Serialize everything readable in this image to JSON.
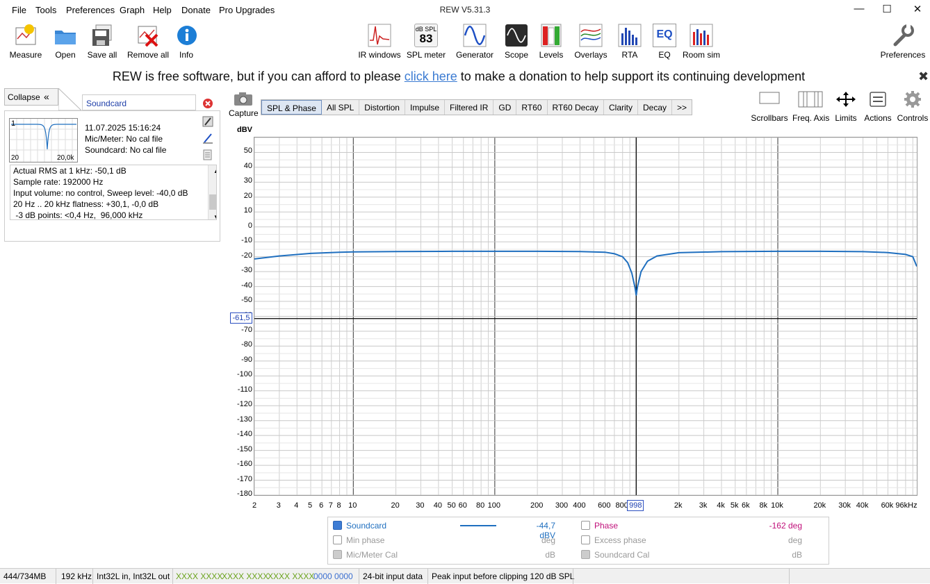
{
  "window": {
    "title": "REW V5.31.3"
  },
  "menu": [
    "File",
    "Tools",
    "Preferences",
    "Graph",
    "Help",
    "Donate",
    "Pro Upgrades"
  ],
  "toolbar_left": [
    "Measure",
    "Open",
    "Save all",
    "Remove all",
    "Info"
  ],
  "toolbar_center": [
    "IR windows",
    "SPL meter",
    "Generator",
    "Scope",
    "Levels",
    "Overlays",
    "RTA",
    "EQ",
    "Room sim"
  ],
  "spl_icon": {
    "unit": "dB SPL",
    "value": "83"
  },
  "eq_icon_text": "EQ",
  "toolbar_right": "Preferences",
  "banner": {
    "before": "REW is free software, but if you can afford to please ",
    "link": "click here",
    "after": " to make a donation to help support its continuing development"
  },
  "measurements": {
    "collapse_label": "Collapse",
    "selected_name": "Soundcard",
    "item": {
      "index": "1",
      "date": "11.07.2025 15:16:24",
      "mic": "Mic/Meter: No cal file",
      "soundcard": "Soundcard: No cal file",
      "thumb_left": "20",
      "thumb_right": "20,0k"
    },
    "info_lines": [
      "Actual RMS at 1 kHz: -50,1 dB",
      "Sample rate: 192000 Hz",
      "Input volume: no control, Sweep level: -40,0 dB",
      "20 Hz .. 20 kHz flatness: +30,1, -0,0 dB",
      " -3 dB points: <0,4 Hz,  96,000 kHz"
    ]
  },
  "capture_label": "Capture",
  "tabs": [
    "SPL & Phase",
    "All SPL",
    "Distortion",
    "Impulse",
    "Filtered IR",
    "GD",
    "RT60",
    "RT60 Decay",
    "Clarity",
    "Decay",
    ">>"
  ],
  "selected_tab": "SPL & Phase",
  "graph_controls": [
    "Scrollbars",
    "Freq. Axis",
    "Limits",
    "Actions",
    "Controls"
  ],
  "chart_data": {
    "type": "line",
    "ylabel": "dBV",
    "xscale": "log",
    "xlim": [
      2,
      96000
    ],
    "ylim": [
      -180,
      60
    ],
    "yticks": [
      "50",
      "40",
      "30",
      "20",
      "10",
      "0",
      "-10",
      "-20",
      "-30",
      "-40",
      "-50",
      "-60",
      "-70",
      "-80",
      "-90",
      "-100",
      "-110",
      "-120",
      "-130",
      "-140",
      "-150",
      "-160",
      "-170",
      "-180"
    ],
    "xticks": [
      {
        "v": 2,
        "l": "2"
      },
      {
        "v": 3,
        "l": "3"
      },
      {
        "v": 4,
        "l": "4"
      },
      {
        "v": 5,
        "l": "5"
      },
      {
        "v": 6,
        "l": "6"
      },
      {
        "v": 7,
        "l": "7"
      },
      {
        "v": 8,
        "l": "8"
      },
      {
        "v": 10,
        "l": "10"
      },
      {
        "v": 20,
        "l": "20"
      },
      {
        "v": 30,
        "l": "30"
      },
      {
        "v": 40,
        "l": "40"
      },
      {
        "v": 50,
        "l": "50"
      },
      {
        "v": 60,
        "l": "60"
      },
      {
        "v": 80,
        "l": "80"
      },
      {
        "v": 100,
        "l": "100"
      },
      {
        "v": 200,
        "l": "200"
      },
      {
        "v": 300,
        "l": "300"
      },
      {
        "v": 400,
        "l": "400"
      },
      {
        "v": 600,
        "l": "600"
      },
      {
        "v": 800,
        "l": "800"
      },
      {
        "v": 2000,
        "l": "2k"
      },
      {
        "v": 3000,
        "l": "3k"
      },
      {
        "v": 4000,
        "l": "4k"
      },
      {
        "v": 5000,
        "l": "5k"
      },
      {
        "v": 6000,
        "l": "6k"
      },
      {
        "v": 8000,
        "l": "8k"
      },
      {
        "v": 10000,
        "l": "10k"
      },
      {
        "v": 20000,
        "l": "20k"
      },
      {
        "v": 30000,
        "l": "30k"
      },
      {
        "v": 40000,
        "l": "40k"
      },
      {
        "v": 60000,
        "l": "60k"
      },
      {
        "v": 96000,
        "l": "96kHz"
      }
    ],
    "cursor": {
      "x": 998,
      "x_label": "998",
      "y": -61.5,
      "y_label": "-61,5"
    },
    "grid": true,
    "series": [
      {
        "name": "Soundcard",
        "color": "#1f6fbf",
        "points": [
          [
            2,
            -21.5
          ],
          [
            3,
            -19.5
          ],
          [
            5,
            -17.8
          ],
          [
            8,
            -17
          ],
          [
            10,
            -16.8
          ],
          [
            20,
            -16.5
          ],
          [
            50,
            -16.4
          ],
          [
            100,
            -16.4
          ],
          [
            200,
            -16.4
          ],
          [
            400,
            -16.5
          ],
          [
            600,
            -17
          ],
          [
            700,
            -18
          ],
          [
            800,
            -20
          ],
          [
            870,
            -24
          ],
          [
            930,
            -31
          ],
          [
            980,
            -41
          ],
          [
            998,
            -46
          ],
          [
            1020,
            -40
          ],
          [
            1080,
            -30
          ],
          [
            1200,
            -23
          ],
          [
            1400,
            -19.5
          ],
          [
            2000,
            -17.3
          ],
          [
            4000,
            -16.6
          ],
          [
            10000,
            -16.4
          ],
          [
            20000,
            -16.4
          ],
          [
            40000,
            -16.6
          ],
          [
            60000,
            -17.2
          ],
          [
            80000,
            -18.5
          ],
          [
            90000,
            -20
          ],
          [
            96000,
            -26.5
          ]
        ]
      }
    ]
  },
  "legend": {
    "soundcard": {
      "label": "Soundcard",
      "value": "-44,7 dBV",
      "color": "#1f6fbf"
    },
    "phase": {
      "label": "Phase",
      "value": "-162 deg",
      "color": "#c0107a"
    },
    "min_phase": {
      "label": "Min phase",
      "value": "deg"
    },
    "excess_phase": {
      "label": "Excess phase",
      "value": "deg"
    },
    "mic_cal": {
      "label": "Mic/Meter Cal",
      "value": "dB"
    },
    "sc_cal": {
      "label": "Soundcard Cal",
      "value": "dB"
    }
  },
  "status": {
    "memory": "444/734MB",
    "rate": "192 kHz",
    "format": "Int32L in, Int32L out",
    "levels": [
      "XXXX XXXX",
      "XXXX XXXX",
      "XXXX XXXX"
    ],
    "levels_color": "#6aa31c",
    "digits": "0000 0000",
    "digits_color": "#3b6fd0",
    "bits": "24-bit input data",
    "peak": "Peak input before clipping 120 dB SPL"
  }
}
